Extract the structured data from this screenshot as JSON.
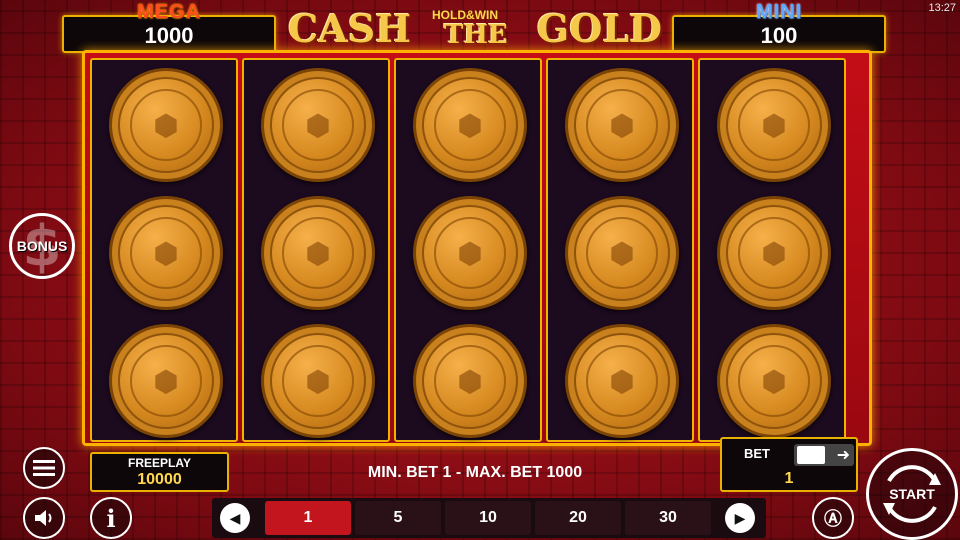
{
  "status": {
    "time": "13:27"
  },
  "logo": {
    "cash": "CASH",
    "hold": "HOLD&WIN",
    "the": "THE",
    "gold": "GOLD"
  },
  "jackpots": {
    "mega": {
      "title": "MEGA",
      "value": "1000"
    },
    "mini": {
      "title": "MINI",
      "value": "100"
    }
  },
  "reels": {
    "columns": 5,
    "rows": 3,
    "symbol": "gold-coin-icon"
  },
  "bonus": {
    "label": "BONUS"
  },
  "freeplay": {
    "label": "FREEPLAY",
    "value": "10000"
  },
  "limits": {
    "text": "MIN. BET 1 - MAX. BET 1000"
  },
  "bet": {
    "label": "BET",
    "value": "1"
  },
  "bet_options": [
    "1",
    "5",
    "10",
    "20",
    "30"
  ],
  "start": {
    "label": "START"
  },
  "colors": {
    "accent": "#e9b200",
    "active_bet": "#c3151d",
    "mega": "#ff4c1f",
    "mini": "#5ea9ff"
  }
}
